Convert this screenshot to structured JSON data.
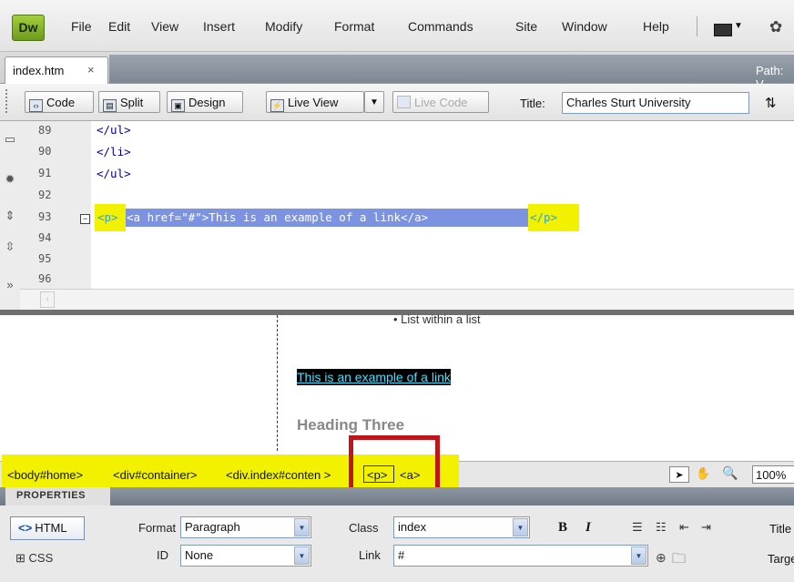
{
  "app": {
    "logo": "Dw"
  },
  "menu": [
    "File",
    "Edit",
    "View",
    "Insert",
    "Modify",
    "Format",
    "Commands",
    "Site",
    "Window",
    "Help"
  ],
  "doc_tab": {
    "label": "index.htm",
    "close": "×",
    "path_label": "Path: V"
  },
  "toolbar": {
    "code_label": "Code",
    "split_label": "Split",
    "design_label": "Design",
    "live_view_label": "Live View",
    "live_code_label": "Live Code",
    "title_label": "Title:",
    "title_value": "Charles Sturt University"
  },
  "code": {
    "line_numbers": [
      "89",
      "90",
      "91",
      "92",
      "93",
      "94",
      "95",
      "96"
    ],
    "line_89": "</ul>",
    "line_90": "</li>",
    "line_91": "</ul>",
    "line_93_open": "<p>",
    "line_93_body": "<a href=\"#\">This is an example of a link</a>",
    "line_93_close": "</p>"
  },
  "design": {
    "bullet_text": "• List within a list",
    "link_text": "This is an example of a link",
    "heading_text": "Heading Three"
  },
  "tag_selector": {
    "body": "<body#home>",
    "container": "<div#container>",
    "content": "<div.index#conten >",
    "p": "<p>",
    "a": "<a>",
    "zoom": "100%"
  },
  "properties": {
    "header": "PROPERTIES",
    "html_label": "HTML",
    "css_label": "CSS",
    "format_label": "Format",
    "format_value": "Paragraph",
    "id_label": "ID",
    "id_value": "None",
    "class_label": "Class",
    "class_value": "index",
    "link_label": "Link",
    "link_value": "#",
    "title_label": "Title",
    "target_label": "Target"
  },
  "colors": {
    "highlight_yellow": "#f2f200",
    "annotation_red": "#c0151a",
    "code_blue": "#0000a0",
    "selection_blue": "#7b93e0",
    "link_cyan": "#3be0ff"
  }
}
